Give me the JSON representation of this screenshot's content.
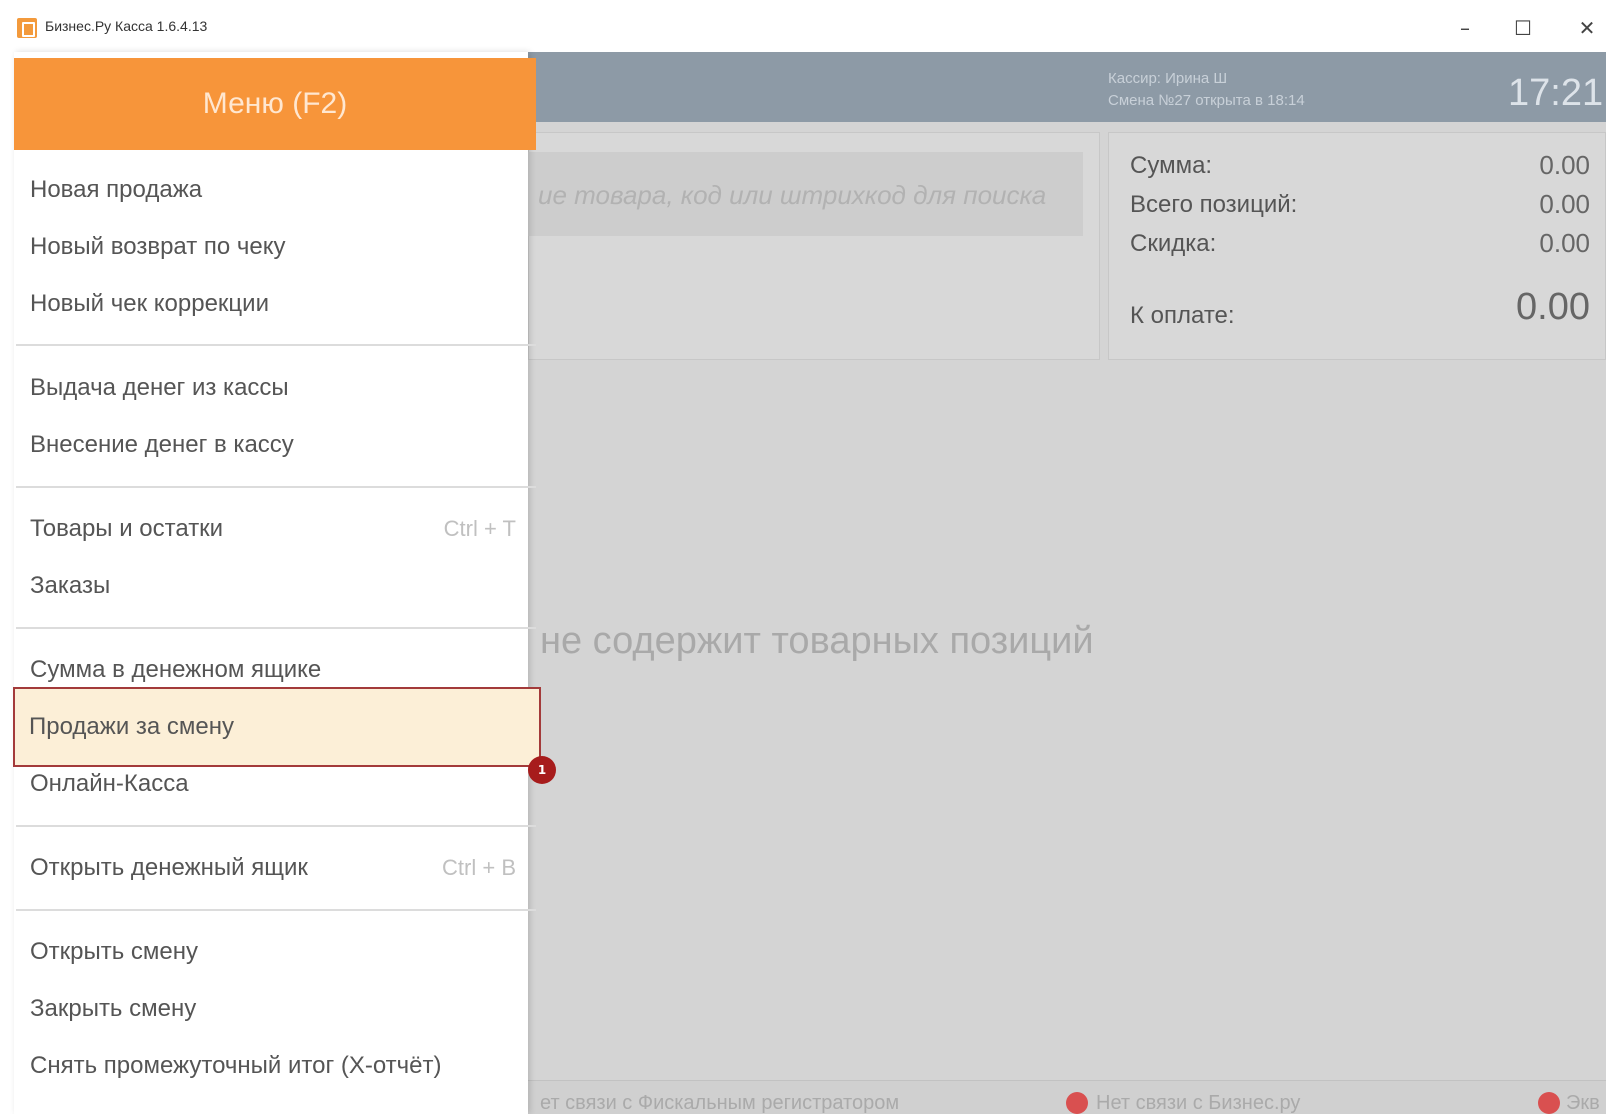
{
  "window": {
    "title": "Бизнес.Ру Касса 1.6.4.13",
    "min_glyph": "–",
    "max_glyph": "☐",
    "close_glyph": "✕"
  },
  "header": {
    "cashier_line": "Кассир: Ирина Ш",
    "shift_line": "Смена №27 открыта в 18:14",
    "clock": "17:21"
  },
  "search": {
    "placeholder": "ие товара, код или штрихкод для поиска"
  },
  "totals": {
    "sum_label": "Сумма:",
    "sum_value": "0.00",
    "positions_label": "Всего позиций:",
    "positions_value": "0.00",
    "discount_label": "Скидка:",
    "discount_value": "0.00",
    "pay_label": "К оплате:",
    "pay_value": "0.00"
  },
  "empty_message": "не содержит товарных позиций",
  "status": {
    "fiscal": "ет связи с Фискальным регистратором",
    "business": "Нет связи с Бизнес.ру",
    "third": "Экв"
  },
  "menu": {
    "title": "Меню (F2)",
    "items": [
      {
        "label": "Новая продажа",
        "shortcut": ""
      },
      {
        "label": "Новый возврат по чеку",
        "shortcut": ""
      },
      {
        "label": "Новый чек коррекции",
        "shortcut": ""
      },
      {
        "label": "Выдача денег из кассы",
        "shortcut": ""
      },
      {
        "label": "Внесение денег в кассу",
        "shortcut": ""
      },
      {
        "label": "Товары и остатки",
        "shortcut": "Ctrl + T"
      },
      {
        "label": "Заказы",
        "shortcut": ""
      },
      {
        "label": "Сумма в денежном ящике",
        "shortcut": ""
      },
      {
        "label": "Продажи за смену",
        "shortcut": ""
      },
      {
        "label": "Онлайн-Касса",
        "shortcut": ""
      },
      {
        "label": "Открыть денежный ящик",
        "shortcut": "Ctrl + B"
      },
      {
        "label": "Открыть смену",
        "shortcut": ""
      },
      {
        "label": "Закрыть смену",
        "shortcut": ""
      },
      {
        "label": "Снять промежуточный итог (X-отчёт)",
        "shortcut": ""
      }
    ],
    "badge": "1"
  },
  "colors": {
    "accent": "#f7953a",
    "highlight_bg": "#fcefd7",
    "highlight_border": "#a33a3a",
    "header_band": "#8d9aa6"
  }
}
